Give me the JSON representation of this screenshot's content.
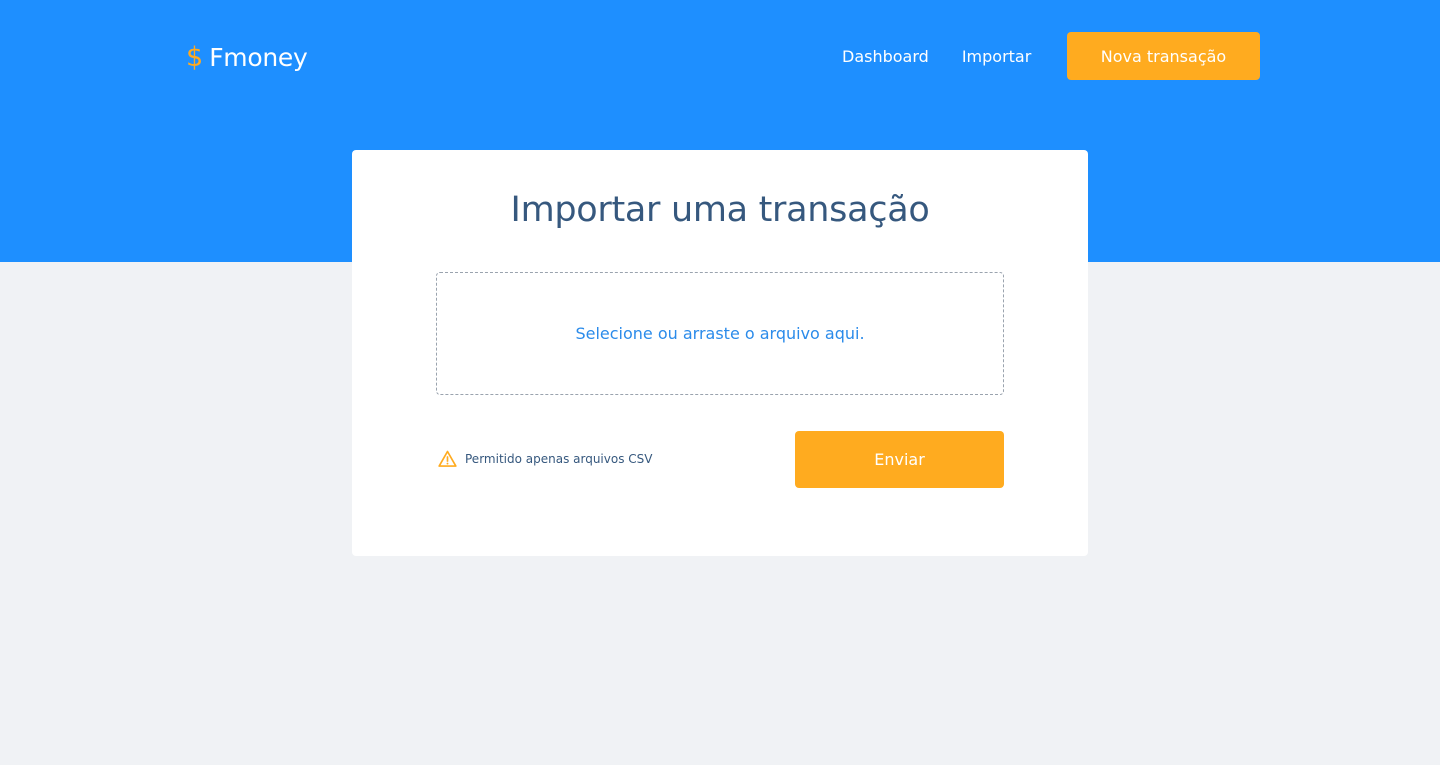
{
  "brand": {
    "name": "Fmoney",
    "icon": "dollar-sign-icon",
    "icon_glyph": "$"
  },
  "nav": {
    "links": [
      {
        "label": "Dashboard"
      },
      {
        "label": "Importar"
      }
    ],
    "cta_label": "Nova transação"
  },
  "main": {
    "title": "Importar uma transação",
    "dropzone_text": "Selecione ou arraste o arquivo aqui.",
    "hint": {
      "icon": "warning-icon",
      "text": "Permitido apenas arquivos CSV"
    },
    "submit_label": "Enviar"
  },
  "colors": {
    "header": "#1E8FFF",
    "accent": "#FFAB1F",
    "page_background": "#F0F2F5",
    "title_text": "#36587E",
    "dropzone_text": "#2B8BEA"
  }
}
